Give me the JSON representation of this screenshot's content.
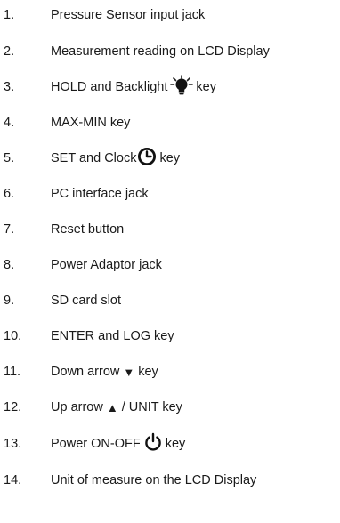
{
  "items": [
    {
      "num": "1.",
      "text": "Pressure Sensor input jack"
    },
    {
      "num": "2.",
      "text": "Measurement reading on LCD Display"
    },
    {
      "num": "3.",
      "pre": "HOLD and Backlight",
      "post": "key",
      "icon": "lightbulb-icon"
    },
    {
      "num": "4.",
      "text": "MAX-MIN key"
    },
    {
      "num": "5.",
      "pre": "SET and Clock",
      "post": "key",
      "icon": "clock-icon"
    },
    {
      "num": "6.",
      "text": "PC interface jack"
    },
    {
      "num": "7.",
      "text": "Reset button"
    },
    {
      "num": "8.",
      "text": "Power Adaptor jack"
    },
    {
      "num": "9.",
      "text": "SD card slot"
    },
    {
      "num": "10.",
      "text": "ENTER and LOG key"
    },
    {
      "num": "11.",
      "pre": "Down arrow",
      "arrow": "▼",
      "post": "key"
    },
    {
      "num": "12.",
      "pre": "Up arrow",
      "arrow": "▲",
      "post": "/ UNIT key"
    },
    {
      "num": "13.",
      "pre": "Power ON-OFF",
      "post": "key",
      "icon": "power-icon"
    },
    {
      "num": "14.",
      "text": "Unit of measure on the LCD Display"
    }
  ]
}
